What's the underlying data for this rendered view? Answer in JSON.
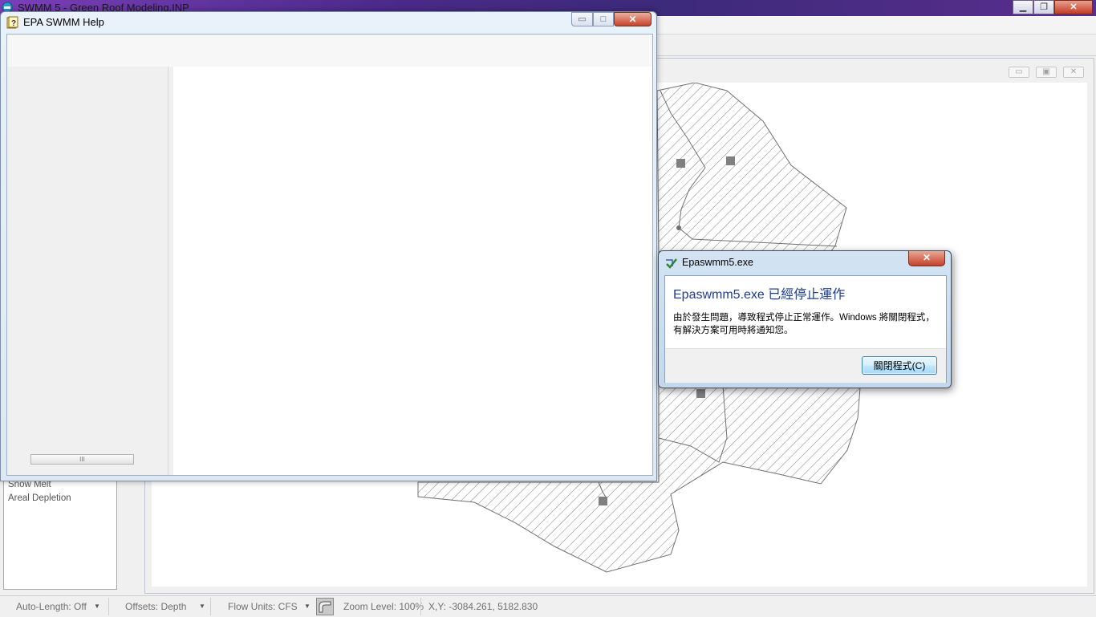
{
  "main_window": {
    "title": "SWMM 5 - Green Roof Modeling.INP",
    "minimize_glyph": "▁",
    "restore_glyph": "❐",
    "close_glyph": "✕"
  },
  "browser": {
    "items": [
      "Snow Melt",
      "Areal Depletion"
    ]
  },
  "map_window": {
    "minimize_glyph": "▭",
    "restore_glyph": "▣",
    "close_glyph": "✕"
  },
  "statusbar": {
    "auto_length": "Auto-Length: Off",
    "offsets": "Offsets: Depth",
    "flow_units": "Flow Units: CFS",
    "zoom_level": "Zoom Level: 100%",
    "coordinates": "X,Y: -3084.261, 5182.830",
    "dropdown_arrow": "▼"
  },
  "help_window": {
    "title": "EPA SWMM Help",
    "minimize_glyph": "▭",
    "maximize_glyph": "□",
    "close_glyph": "✕",
    "scroll_grip": "III"
  },
  "error_dialog": {
    "title": "Epaswmm5.exe",
    "heading": "Epaswmm5.exe 已經停止運作",
    "message": "由於發生問題，導致程式停止正常運作。Windows 將關閉程式，有解決方案可用時將通知您。",
    "button_label": "關閉程式(C)",
    "close_glyph": "✕"
  },
  "colors": {
    "title_bar_purple": "#4b2a8a",
    "dialog_heading_blue": "#1e3c96",
    "close_red": "#c6412a",
    "map_line": "#707070"
  }
}
